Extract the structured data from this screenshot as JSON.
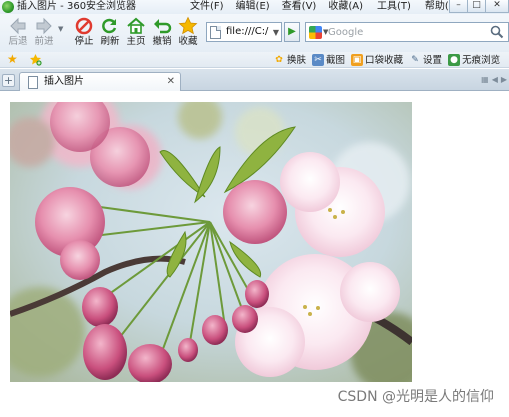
{
  "window": {
    "title": "插入图片 - 360安全浏览器",
    "controls": {
      "minimize": "–",
      "maximize": "□",
      "close": "✕"
    }
  },
  "menu": {
    "items": [
      "文件(F)",
      "编辑(E)",
      "查看(V)",
      "收藏(A)",
      "工具(T)",
      "帮助(H)"
    ]
  },
  "toolbar": {
    "back_label": "后退",
    "forward_label": "前进",
    "stop_label": "停止",
    "refresh_label": "刷新",
    "home_label": "主页",
    "undo_label": "撤销",
    "favorites_label": "收藏"
  },
  "address_bar": {
    "value": "file:///C:/"
  },
  "search": {
    "engine": "Google",
    "placeholder": "Google"
  },
  "links_bar": {
    "items": [
      {
        "label": "换肤",
        "icon": "skin-icon"
      },
      {
        "label": "截图",
        "icon": "screenshot-icon"
      },
      {
        "label": "口袋收藏",
        "icon": "pocket-favorites-icon"
      },
      {
        "label": "设置",
        "icon": "settings-icon"
      },
      {
        "label": "无痕浏览",
        "icon": "incognito-icon"
      }
    ]
  },
  "tabs": [
    {
      "label": "插入图片",
      "active": true
    }
  ],
  "content": {
    "image_subject": "pink cherry blossoms",
    "watermark": "CSDN @光明是人的信仰"
  },
  "colors": {
    "chrome_top": "#f3f7fb",
    "chrome_border": "#8fa7bf",
    "accent_green": "#2f9a2a",
    "stop_red": "#e03a2f"
  }
}
